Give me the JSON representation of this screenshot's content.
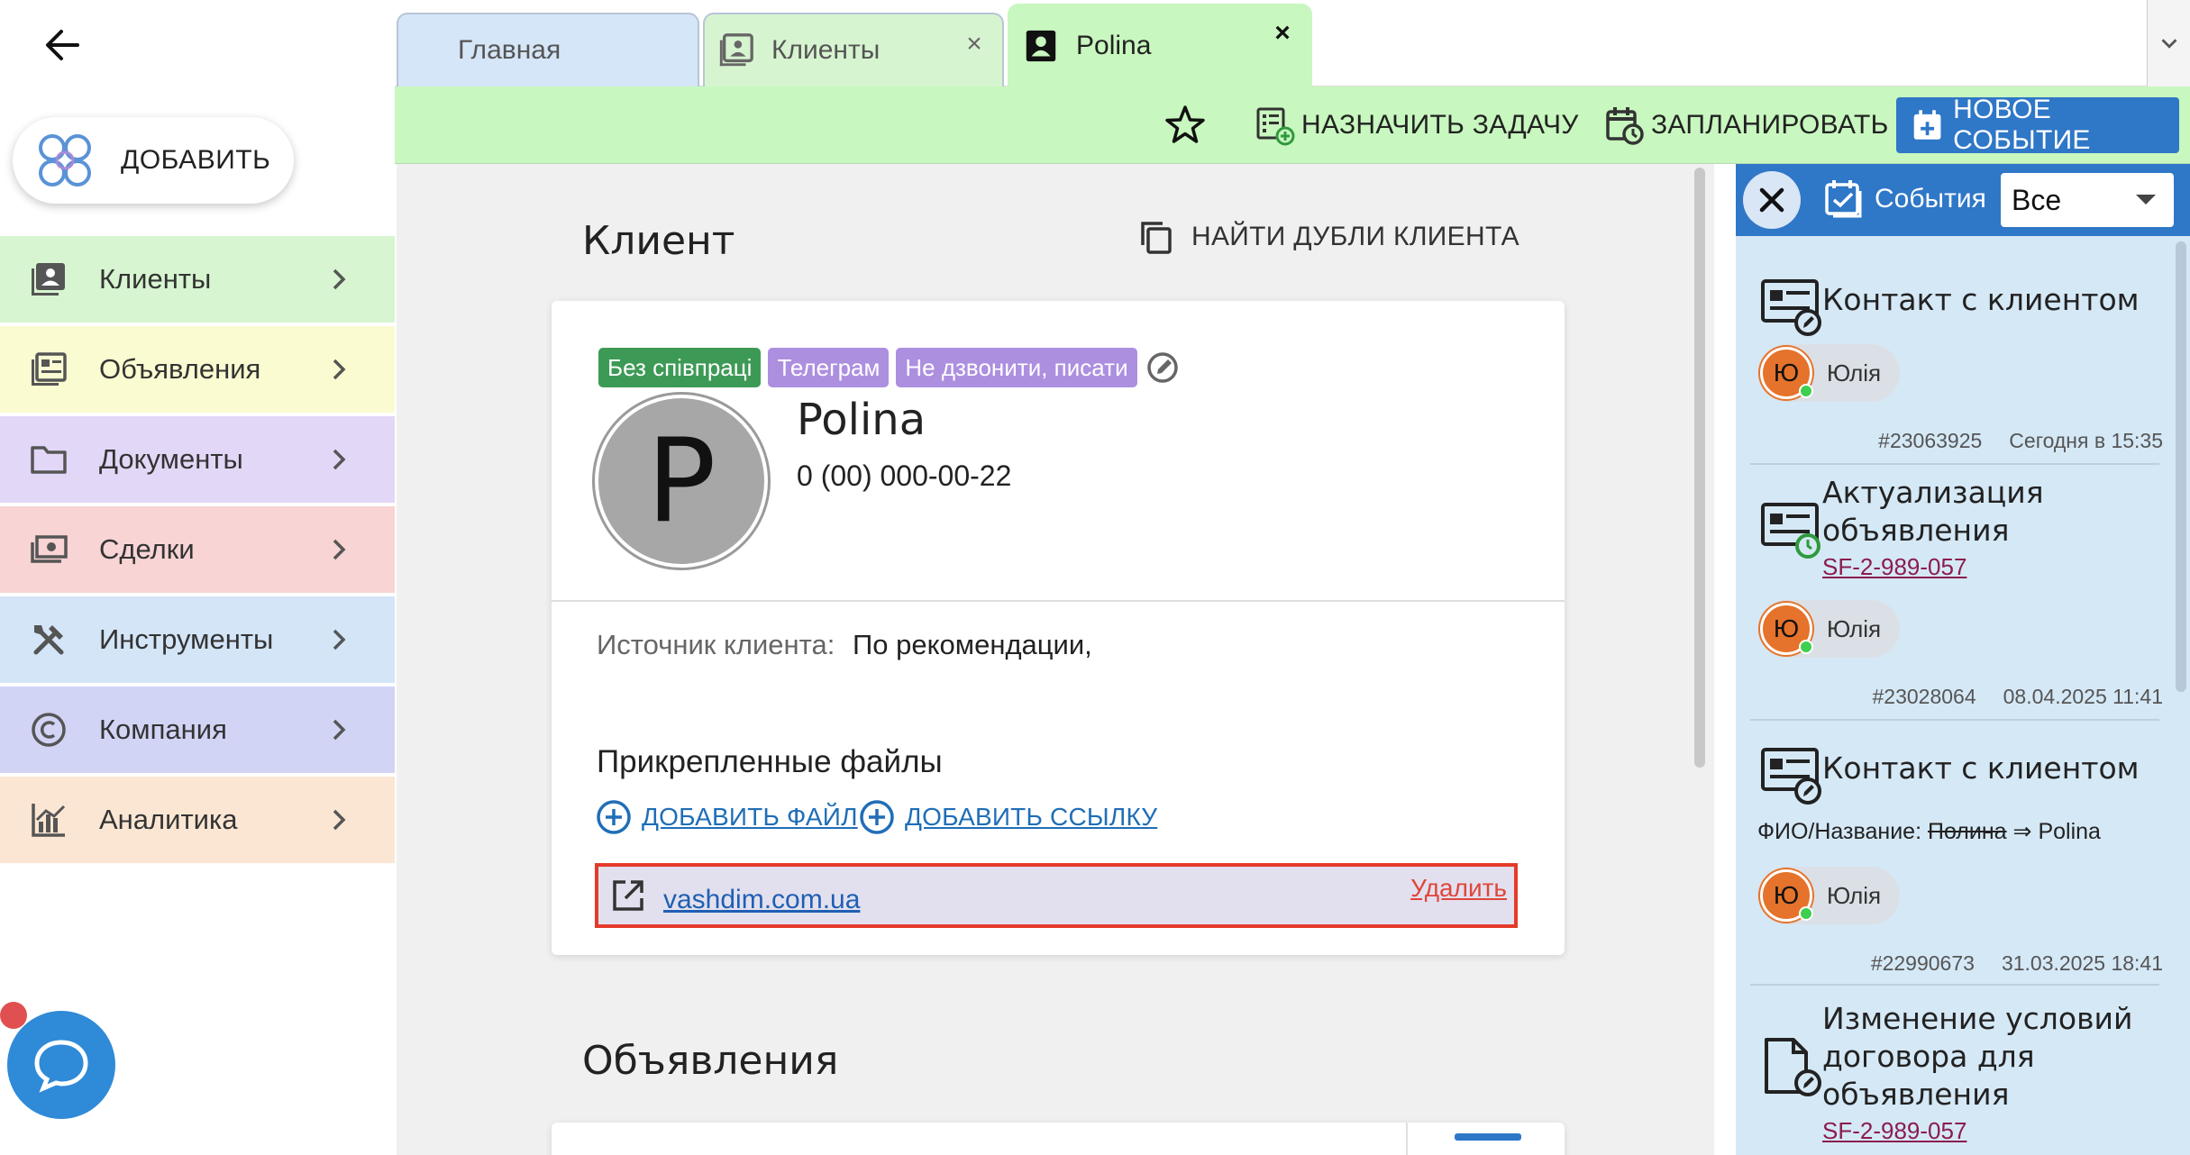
{
  "sidebar": {
    "add_label": "ДОБАВИТЬ",
    "items": [
      {
        "label": "Клиенты",
        "icon": "contacts-icon",
        "bg": "#d6f5d0"
      },
      {
        "label": "Объявления",
        "icon": "listings-icon",
        "bg": "#fbfbd2"
      },
      {
        "label": "Документы",
        "icon": "folder-icon",
        "bg": "#e3d7f7"
      },
      {
        "label": "Сделки",
        "icon": "money-icon",
        "bg": "#f8d4d4"
      },
      {
        "label": "Инструменты",
        "icon": "tools-icon",
        "bg": "#d3e5f7"
      },
      {
        "label": "Компания",
        "icon": "copyright-icon",
        "bg": "#d2d4f6"
      },
      {
        "label": "Аналитика",
        "icon": "analytics-icon",
        "bg": "#fbe6d3"
      }
    ]
  },
  "tabs": {
    "home": "Главная",
    "clients": "Клиенты",
    "active": "Polina",
    "close": "×"
  },
  "toolbar": {
    "assign": "НАЗНАЧИТЬ ЗАДАЧУ",
    "plan": "ЗАПЛАНИРОВАТЬ",
    "new_event": "НОВОЕ СОБЫТИЕ"
  },
  "client": {
    "section_title": "Клиент",
    "find_duplicates": "НАЙТИ ДУБЛИ КЛИЕНТА",
    "tags": [
      "Без співпраці",
      "Телеграм",
      "Не дзвонити, писати"
    ],
    "avatar_letter": "P",
    "name": "Polina",
    "phone": "0 (00) 000-00-22",
    "source_label": "Источник клиента:",
    "source_value": "По рекомендации,",
    "files_title": "Прикрепленные файлы",
    "add_file": "ДОБАВИТЬ ФАЙЛ",
    "add_link": "ДОБАВИТЬ ССЫЛКУ",
    "link_text": "vashdim.com.ua",
    "delete": "Удалить"
  },
  "listings": {
    "section_title": "Объявления"
  },
  "events": {
    "title": "События",
    "filter": "Все",
    "items": [
      {
        "name": "Контакт с клиентом",
        "user_initial": "Ю",
        "user": "Юлія",
        "id": "#23063925",
        "date": "Сегодня в 15:35"
      },
      {
        "name_line1": "Актуализация",
        "name_line2": "объявления",
        "link": "SF-2-989-057",
        "user_initial": "Ю",
        "user": "Юлія",
        "id": "#23028064",
        "date": "08.04.2025 11:41"
      },
      {
        "name": "Контакт с клиентом",
        "change_label": "ФИО/Название:",
        "change_old": "Полина",
        "change_arrow": "⇒",
        "change_new": "Polina",
        "user_initial": "Ю",
        "user": "Юлія",
        "id": "#22990673",
        "date": "31.03.2025 18:41"
      },
      {
        "name_line1": "Изменение условий",
        "name_line2": "договора для",
        "name_line3": "объявления",
        "link": "SF-2-989-057"
      }
    ]
  }
}
